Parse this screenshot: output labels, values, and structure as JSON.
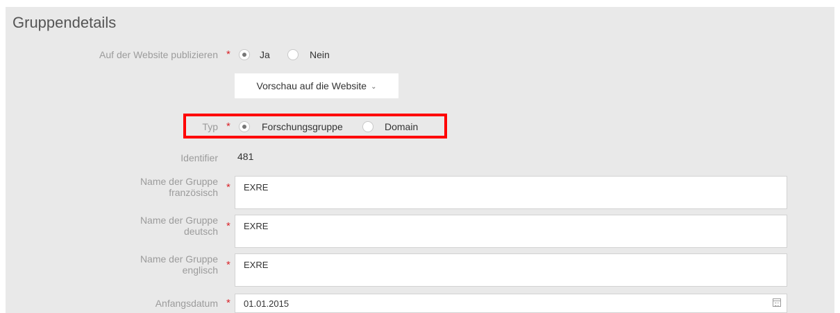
{
  "section": {
    "title": "Gruppendetails"
  },
  "publish": {
    "label": "Auf der Website publizieren",
    "required_mark": "*",
    "options": [
      {
        "label": "Ja",
        "selected": true
      },
      {
        "label": "Nein",
        "selected": false
      }
    ],
    "preview_button": "Vorschau auf die Website",
    "preview_chevron": "⌄"
  },
  "type": {
    "label": "Typ",
    "required_mark": "*",
    "options": [
      {
        "label": "Forschungsgruppe",
        "selected": true
      },
      {
        "label": "Domain",
        "selected": false
      }
    ]
  },
  "identifier": {
    "label": "Identifier",
    "value": "481"
  },
  "name_fr": {
    "label_line1": "Name der Gruppe",
    "label_line2": "französisch",
    "required_mark": "*",
    "value": "EXRE"
  },
  "name_de": {
    "label_line1": "Name der Gruppe",
    "label_line2": "deutsch",
    "required_mark": "*",
    "value": "EXRE"
  },
  "name_en": {
    "label_line1": "Name der Gruppe",
    "label_line2": "englisch",
    "required_mark": "*",
    "value": "EXRE"
  },
  "start_date": {
    "label": "Anfangsdatum",
    "required_mark": "*",
    "value": "01.01.2015",
    "icon": "calendar-icon"
  },
  "colors": {
    "required": "#d9252b",
    "highlight": "#ff0000",
    "panel": "#e9e9e9"
  }
}
